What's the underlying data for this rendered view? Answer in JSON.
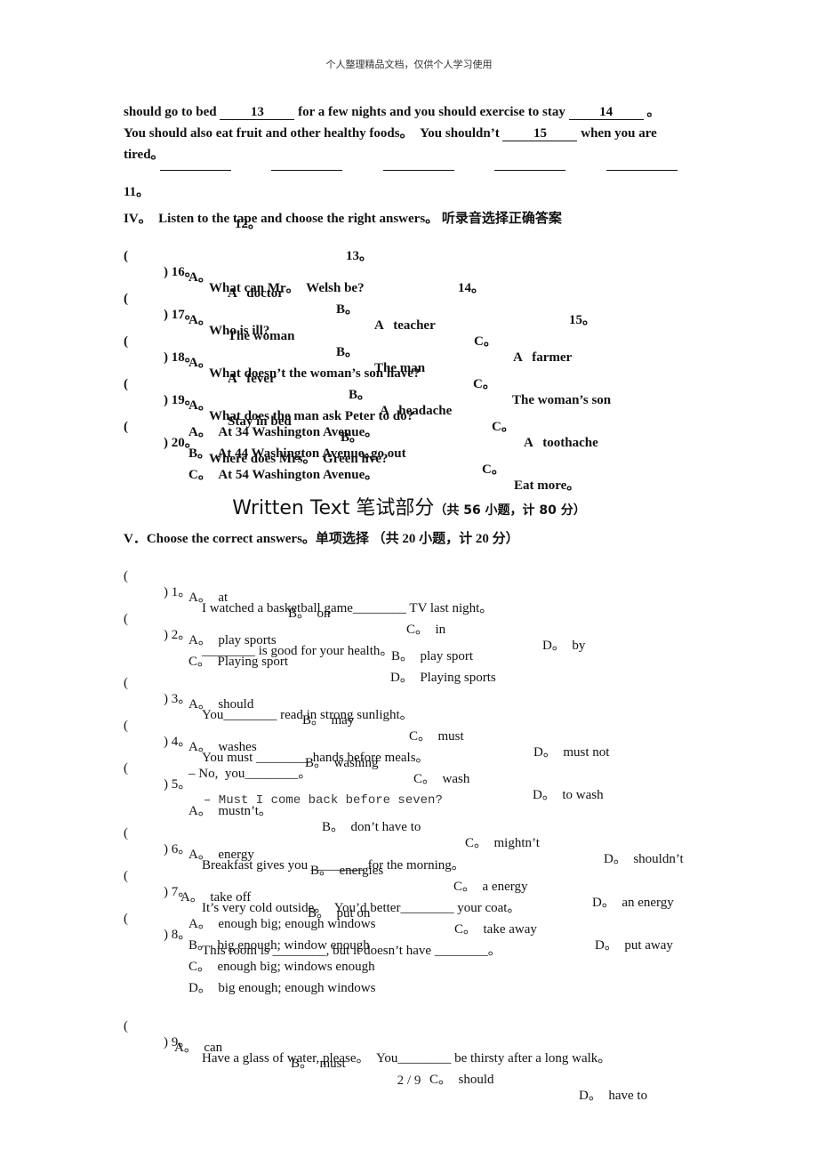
{
  "header": "个人整理精品文档，仅供个人学习使用",
  "footer": {
    "page": "2 / 9"
  },
  "passage": {
    "line1_a": "should go to bed ",
    "blank13": "13",
    "line1_b": " for a few nights and you should exercise to stay ",
    "blank14": "14",
    "line1_c": " 。",
    "line2_a": "You should also eat fruit and other healthy foods。  You shouldn’t ",
    "blank15": "15",
    "line2_b": " when you are",
    "line3": "tired。"
  },
  "answer_row": [
    "11。",
    "12。",
    "13。",
    "14。",
    "15。"
  ],
  "section4": {
    "title": "IV。  Listen to the tape and choose the right answers。 听录音选择正确答案",
    "questions": [
      {
        "num": ") 16。",
        "text": "What can Mr。  Welsh be?",
        "options": [
          "A。",
          "A   doctor",
          "B。",
          "A   teacher",
          "C。",
          "A   farmer"
        ]
      },
      {
        "num": ") 17。",
        "text": "Who is ill?",
        "options": [
          "A。",
          "The woman",
          "B。",
          "The man",
          "C。",
          "The woman’s son"
        ]
      },
      {
        "num": ") 18。",
        "text": "What doesn’t the woman’s son have?",
        "options": [
          "A。",
          "A   fever",
          "B。",
          "A   headache",
          "C。",
          "A   toothache"
        ]
      },
      {
        "num": ") 19。",
        "text": "What does the man ask Peter to do?",
        "options": [
          "A。",
          "Stay in bed",
          "B。",
          "go out",
          "C。",
          "Eat more。"
        ]
      },
      {
        "num": ") 20。",
        "text": "Where does Mrs。  Green live?",
        "options": [
          "A。  At 34 Washington Avenue。",
          "B。  At 44 Washington Avenue。",
          "C。  At 54 Washington Avenue。"
        ]
      }
    ]
  },
  "written": {
    "title": "Written Text 笔试部分",
    "subtitle": "（共 56 小题，计 80 分）"
  },
  "section5": {
    "title": "V．Choose the correct answers。单项选择 （共 20 小题，计 20 分）",
    "questions": [
      {
        "num": ") 1。",
        "text": "I watched a basketball game________ TV last night。",
        "options": [
          "A。  at",
          "B。  on",
          "C。  in",
          "D。  by"
        ]
      },
      {
        "num": ") 2。",
        "text": "________ is good for your health。",
        "options": [
          "A。  play sports",
          "B。  play sport",
          "C。  Playing sport",
          "D。  Playing sports"
        ]
      },
      {
        "num": ") 3。",
        "text": "You________ read in strong sunlight。",
        "options": [
          "A。  should",
          "B。  may",
          "C。  must",
          "D。  must not"
        ]
      },
      {
        "num": ") 4。",
        "text": "You must ________ hands before meals。",
        "options": [
          "A。  washes",
          "B。  washing",
          "C。  wash",
          "D。  to wash"
        ]
      },
      {
        "num": ") 5。",
        "text": "– Must I come back before seven?",
        "text2": "– No,  you________。",
        "options": [
          "A。  mustn’t。",
          "B。  don’t have to",
          "C。  mightn’t",
          "D。  shouldn’t"
        ]
      },
      {
        "num": ") 6。",
        "text": "Breakfast gives you ________ for the morning。",
        "options": [
          "A。  energy",
          "B。  energies",
          "C。  a energy",
          "D。  an energy"
        ]
      },
      {
        "num": ") 7。",
        "text": "It’s very cold outside。  You’d better________ your coat。",
        "options": [
          "A。  take off",
          "B。  put on",
          "C。  take away",
          "D。  put away"
        ]
      },
      {
        "num": ") 8。",
        "text": "This room is ________, but it doesn’t have ________。",
        "options": [
          "A。  enough big; enough windows",
          "B。  big enough; window enough",
          "C。  enough big; windows enough",
          "D。  big enough; enough windows"
        ]
      },
      {
        "num": ") 9。",
        "text": "Have a glass of water, please。  You________ be thirsty after a long walk。",
        "options": [
          "A。  can",
          "B。  must",
          "C。  should",
          "D。  have to"
        ]
      }
    ]
  },
  "paren_open": "("
}
